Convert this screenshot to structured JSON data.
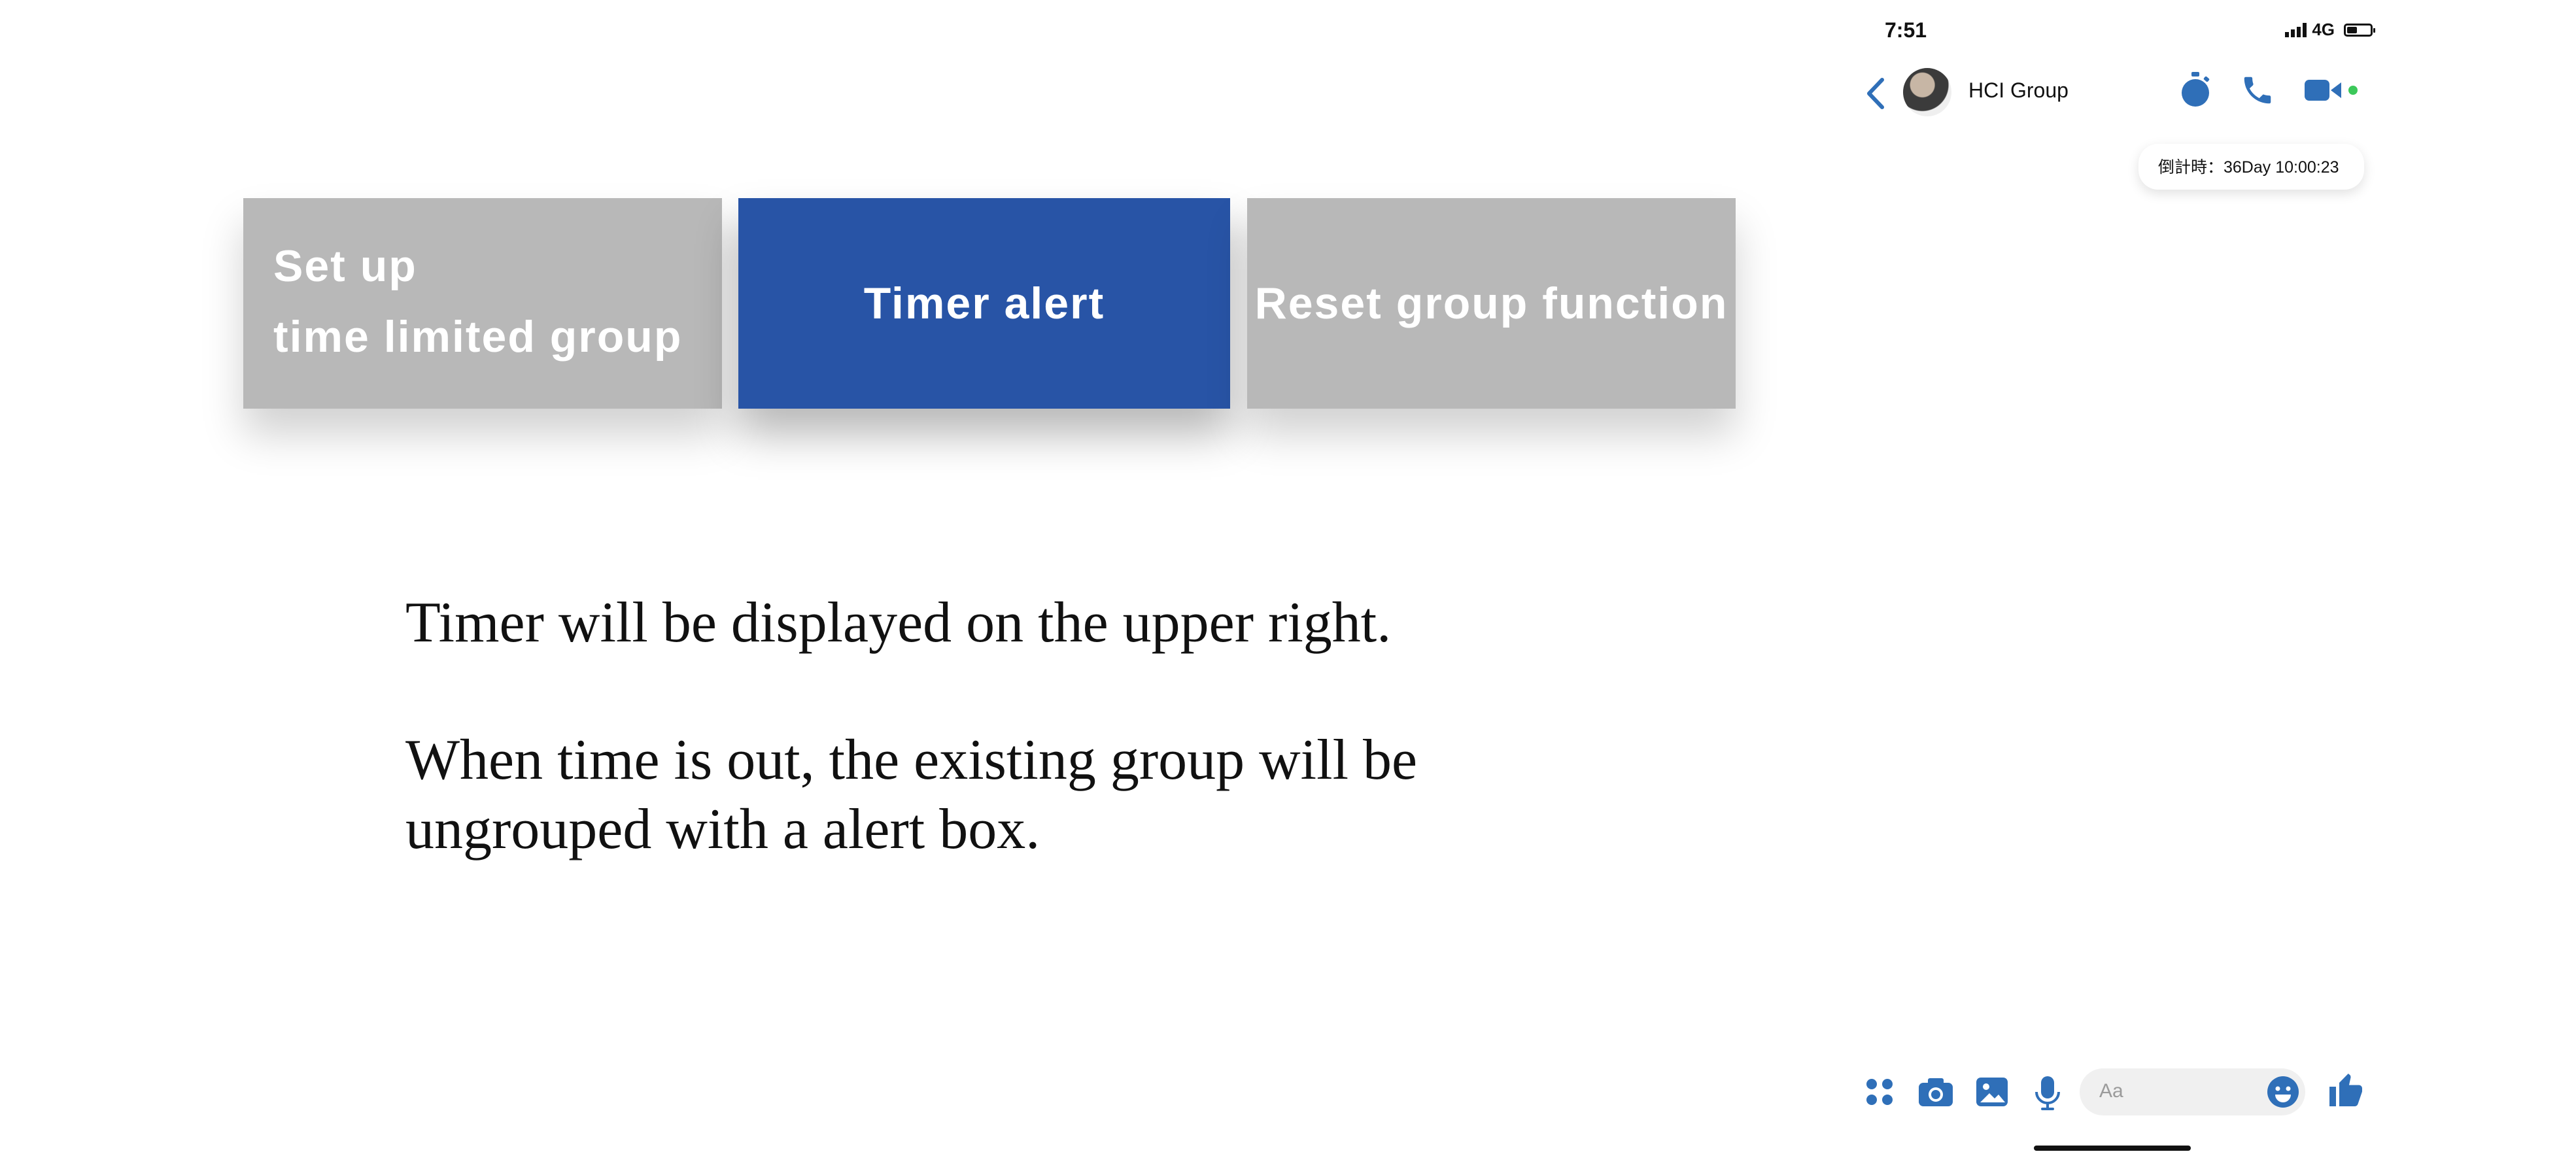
{
  "slide": {
    "tabs": [
      {
        "line1": "Set up",
        "line2": "time limited group"
      },
      {
        "label": "Timer alert"
      },
      {
        "label": "Reset group function"
      }
    ],
    "descriptions": [
      "Timer will be displayed on the upper right.",
      "When time is out, the existing group will be ungrouped with a alert box."
    ]
  },
  "phone": {
    "status_bar": {
      "time": "7:51",
      "network": "4G"
    },
    "header": {
      "group_name": "HCI Group"
    },
    "timer": {
      "text": "倒計時：36Day 10:00:23"
    },
    "composer": {
      "placeholder": "Aa"
    }
  },
  "colors": {
    "accent_blue": "#2854a6",
    "tab_grey": "#b8b8b8",
    "icon_blue": "#2f6fb8",
    "online_green": "#3cc85a"
  }
}
